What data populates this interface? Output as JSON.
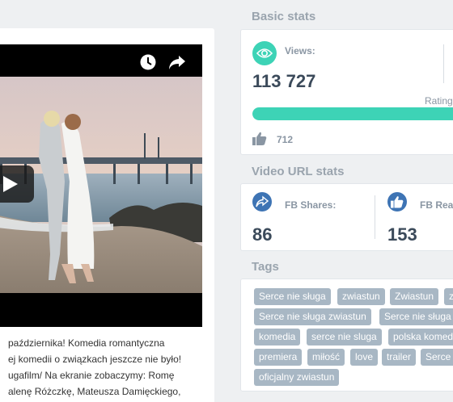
{
  "video": {
    "player_icons": [
      "clock-icon",
      "share-arrow-icon",
      "play-icon"
    ],
    "description_lines": [
      "października! Komedia romantyczna",
      "ej komedii o związkach jeszcze nie było!",
      "ugafilm/ Na ekranie zobaczymy: Romę",
      "alenę Różczkę, Mateusza Damięckiego,"
    ]
  },
  "basic_stats": {
    "title": "Basic stats",
    "views_label": "Views:",
    "views_value": "113 727",
    "rating_label": "Rating",
    "rating_fraction": 1.0,
    "likes": "712",
    "accent": "#3dd3b6"
  },
  "url_stats": {
    "title": "Video URL stats",
    "fb_shares_label": "FB Shares:",
    "fb_shares_value": "86",
    "fb_reactions_label": "FB Rea",
    "fb_reactions_value": "153",
    "accent": "#3e74b4"
  },
  "tags": {
    "title": "Tags",
    "items": [
      "Serce nie sługa",
      "zwiastun",
      "Zwiastun",
      "z",
      "Serce nie sługa zwiastun",
      "Serce nie sługa",
      "komedia",
      "serce nie sluga",
      "polska komedi",
      "premiera",
      "miłość",
      "love",
      "trailer",
      "Serce",
      "oficjalny zwiastun"
    ],
    "color": "#a8b7c4"
  }
}
